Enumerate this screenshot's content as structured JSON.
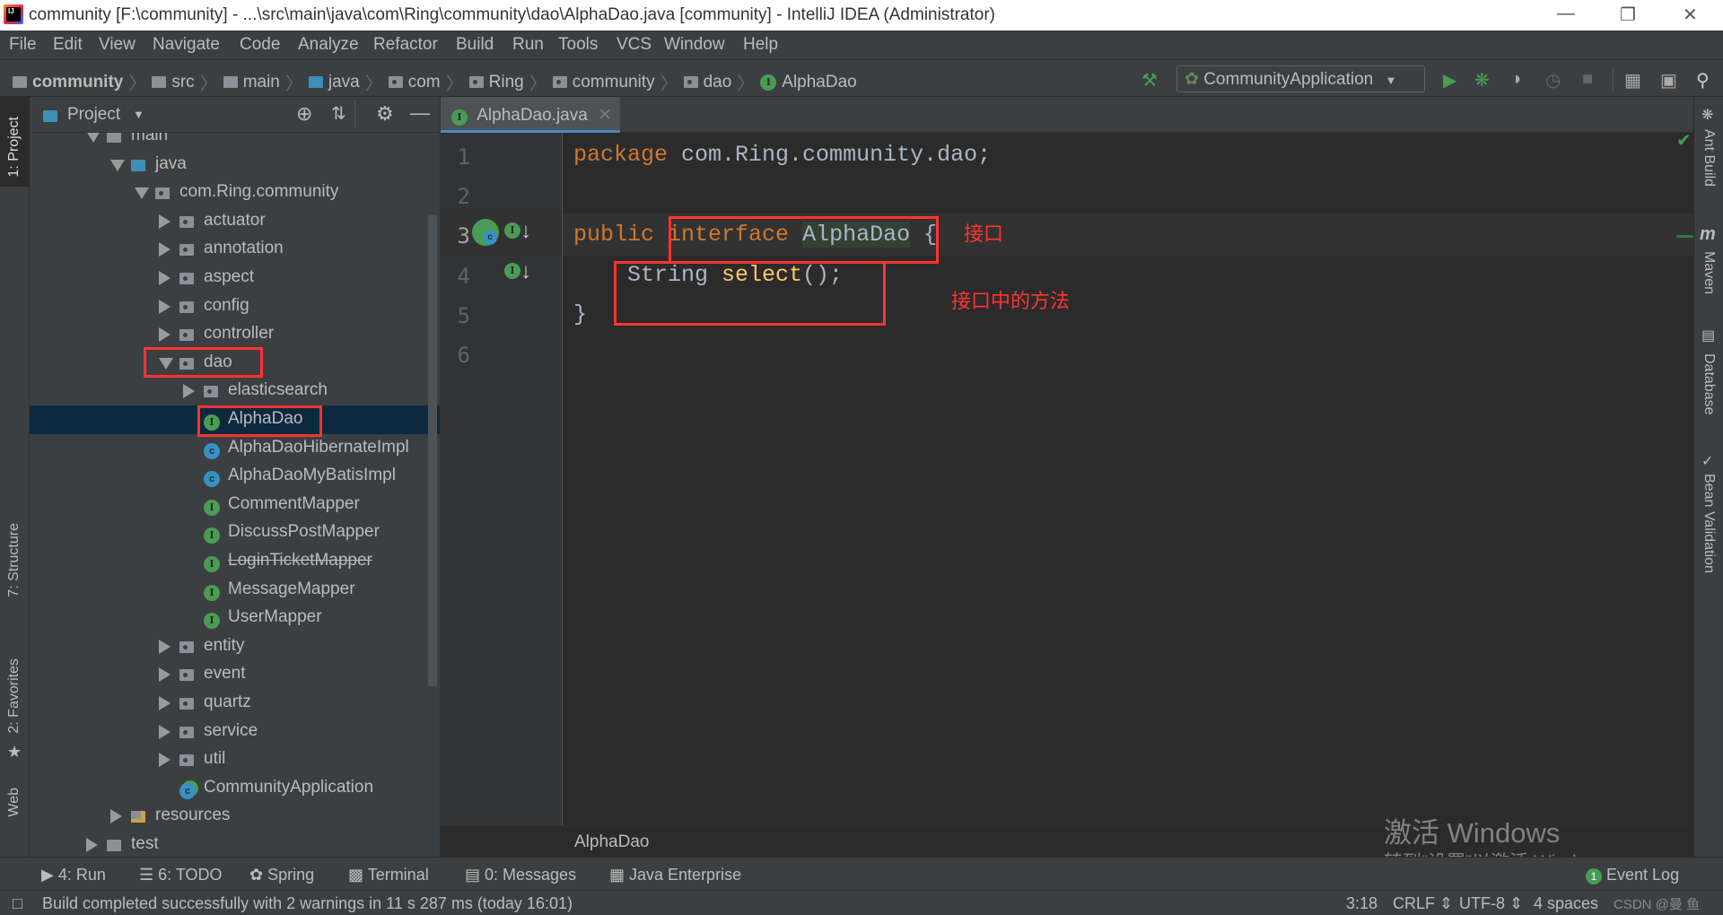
{
  "window": {
    "title": "community [F:\\community] - ...\\src\\main\\java\\com\\Ring\\community\\dao\\AlphaDao.java [community] - IntelliJ IDEA (Administrator)",
    "logo_text": "IJ"
  },
  "menu": [
    "File",
    "Edit",
    "View",
    "Navigate",
    "Code",
    "Analyze",
    "Refactor",
    "Build",
    "Run",
    "Tools",
    "VCS",
    "Window",
    "Help"
  ],
  "breadcrumb": [
    "community",
    "src",
    "main",
    "java",
    "com",
    "Ring",
    "community",
    "dao",
    "AlphaDao"
  ],
  "run_config": "CommunityApplication",
  "project_panel": {
    "title": "Project",
    "tree": [
      {
        "label": "main",
        "level": 0,
        "type": "folder",
        "arrow": "down"
      },
      {
        "label": "java",
        "level": 1,
        "type": "srcfolder",
        "arrow": "down"
      },
      {
        "label": "com.Ring.community",
        "level": 2,
        "type": "package",
        "arrow": "down"
      },
      {
        "label": "actuator",
        "level": 3,
        "type": "package",
        "arrow": "right"
      },
      {
        "label": "annotation",
        "level": 3,
        "type": "package",
        "arrow": "right"
      },
      {
        "label": "aspect",
        "level": 3,
        "type": "package",
        "arrow": "right"
      },
      {
        "label": "config",
        "level": 3,
        "type": "package",
        "arrow": "right"
      },
      {
        "label": "controller",
        "level": 3,
        "type": "package",
        "arrow": "right"
      },
      {
        "label": "dao",
        "level": 3,
        "type": "package",
        "arrow": "down"
      },
      {
        "label": "elasticsearch",
        "level": 4,
        "type": "package",
        "arrow": "right"
      },
      {
        "label": "AlphaDao",
        "level": 4,
        "type": "interface",
        "selected": true
      },
      {
        "label": "AlphaDaoHibernateImpl",
        "level": 4,
        "type": "class"
      },
      {
        "label": "AlphaDaoMyBatisImpl",
        "level": 4,
        "type": "class"
      },
      {
        "label": "CommentMapper",
        "level": 4,
        "type": "interface"
      },
      {
        "label": "DiscussPostMapper",
        "level": 4,
        "type": "interface"
      },
      {
        "label": "LoginTicketMapper",
        "level": 4,
        "type": "interface",
        "deprecated": true
      },
      {
        "label": "MessageMapper",
        "level": 4,
        "type": "interface"
      },
      {
        "label": "UserMapper",
        "level": 4,
        "type": "interface"
      },
      {
        "label": "entity",
        "level": 3,
        "type": "package",
        "arrow": "right"
      },
      {
        "label": "event",
        "level": 3,
        "type": "package",
        "arrow": "right"
      },
      {
        "label": "quartz",
        "level": 3,
        "type": "package",
        "arrow": "right"
      },
      {
        "label": "service",
        "level": 3,
        "type": "package",
        "arrow": "right"
      },
      {
        "label": "util",
        "level": 3,
        "type": "package",
        "arrow": "right"
      },
      {
        "label": "CommunityApplication",
        "level": 3,
        "type": "app"
      },
      {
        "label": "resources",
        "level": 1,
        "type": "resources",
        "arrow": "right"
      },
      {
        "label": "test",
        "level": 0,
        "type": "folder",
        "arrow": "right"
      }
    ]
  },
  "editor": {
    "tab": "AlphaDao.java",
    "line_numbers": [
      "1",
      "2",
      "3",
      "4",
      "5",
      "6"
    ],
    "code": {
      "l1_kw": "package",
      "l1_rest": " com.Ring.community.dao;",
      "l3_kw1": "public",
      "l3_kw2": "interface",
      "l3_name": "AlphaDao",
      "l3_brace": " {",
      "l4_type": "    String ",
      "l4_method": "select",
      "l4_rest": "();",
      "l5": "}"
    },
    "annotations": {
      "interface_note": "接口",
      "method_note": "接口中的方法"
    },
    "breadcrumb": "AlphaDao"
  },
  "left_tools": [
    "1: Project",
    "7: Structure",
    "2: Favorites",
    "Web"
  ],
  "right_tools": [
    "Ant Build",
    "Maven",
    "Database",
    "Bean Validation"
  ],
  "bottom_tools": [
    "4: Run",
    "6: TODO",
    "Spring",
    "Terminal",
    "0: Messages",
    "Java Enterprise"
  ],
  "event_log": {
    "label": "Event Log",
    "count": "1"
  },
  "status": {
    "message": "Build completed successfully with 2 warnings in 11 s 287 ms (today 16:01)",
    "position": "3:18",
    "line_sep": "CRLF",
    "encoding": "UTF-8",
    "indent": "4 spaces"
  },
  "watermark": {
    "line1": "激活 Windows",
    "line2": "转到“设置”以激活 Windows。",
    "csdn": "CSDN @曼 鱼"
  },
  "colors": {
    "keyword": "#cc7832",
    "method": "#ffc66d",
    "text": "#a9b7c6",
    "annotation": "#ff3333",
    "selection": "#0d293e"
  }
}
